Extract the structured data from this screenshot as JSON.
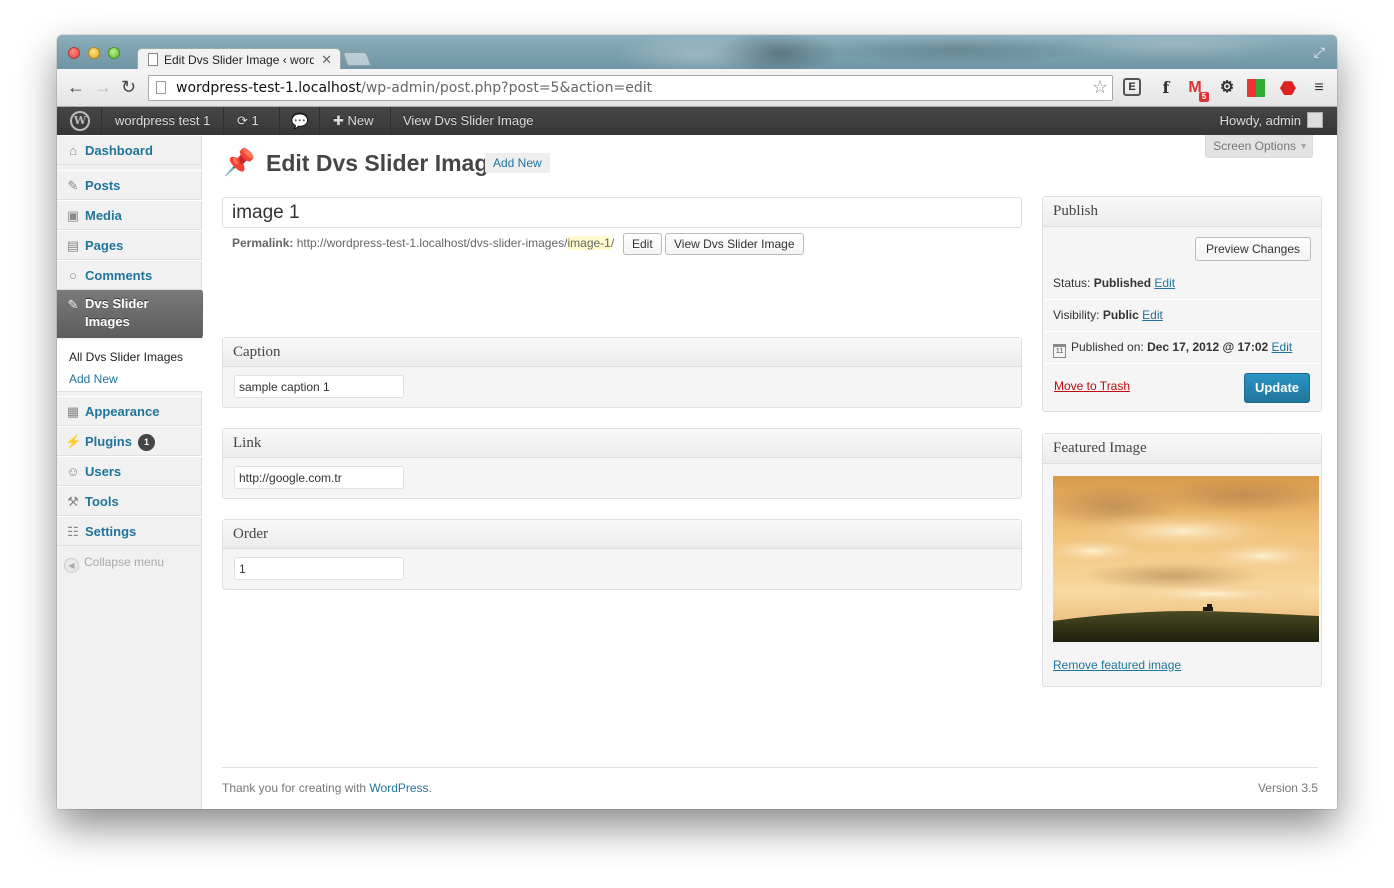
{
  "browser": {
    "tab_title": "Edit Dvs Slider Image ‹ word",
    "url_host": "wordpress-test-1.localhost",
    "url_path": "/wp-admin/post.php?post=5&action=edit",
    "gmail_count": "5"
  },
  "adminbar": {
    "site_name": "wordpress test 1",
    "updates_count": "1",
    "new_label": "New",
    "view_label": "View Dvs Slider Image",
    "howdy": "Howdy, admin"
  },
  "sidebar": {
    "items": [
      {
        "label": "Dashboard",
        "icon": "dashboard-icon"
      },
      {
        "label": "Posts",
        "icon": "pin-icon"
      },
      {
        "label": "Media",
        "icon": "media-icon"
      },
      {
        "label": "Pages",
        "icon": "pages-icon"
      },
      {
        "label": "Comments",
        "icon": "comments-icon"
      },
      {
        "label": "Dvs Slider Images",
        "icon": "pin-icon"
      },
      {
        "label": "Appearance",
        "icon": "appearance-icon"
      },
      {
        "label": "Plugins",
        "icon": "plugins-icon",
        "badge": "1"
      },
      {
        "label": "Users",
        "icon": "users-icon"
      },
      {
        "label": "Tools",
        "icon": "tools-icon"
      },
      {
        "label": "Settings",
        "icon": "settings-icon"
      }
    ],
    "submenu": [
      "All Dvs Slider Images",
      "Add New"
    ],
    "collapse": "Collapse menu"
  },
  "main": {
    "title": "Edit Dvs Slider Image",
    "add_new": "Add New",
    "screen_options": "Screen Options",
    "post_title": "image 1",
    "permalink_label": "Permalink:",
    "permalink_base": "http://wordpress-test-1.localhost/dvs-slider-images/",
    "permalink_slug": "image-1",
    "permalink_end": "/",
    "edit_button": "Edit",
    "view_button": "View Dvs Slider Image",
    "metaboxes": [
      {
        "title": "Caption",
        "value": "sample caption 1"
      },
      {
        "title": "Link",
        "value": "http://google.com.tr"
      },
      {
        "title": "Order",
        "value": "1"
      }
    ]
  },
  "publish": {
    "title": "Publish",
    "preview_button": "Preview Changes",
    "status_label": "Status:",
    "status_value": "Published",
    "visibility_label": "Visibility:",
    "visibility_value": "Public",
    "published_label": "Published on:",
    "published_value": "Dec 17, 2012 @ 17:02",
    "edit_link": "Edit",
    "calendar_day": "11",
    "trash": "Move to Trash",
    "update_button": "Update"
  },
  "featured": {
    "title": "Featured Image",
    "remove_link": "Remove featured image"
  },
  "footer": {
    "thanks": "Thank you for creating with",
    "wordpress": "WordPress",
    "period": ".",
    "version": "Version 3.5"
  }
}
